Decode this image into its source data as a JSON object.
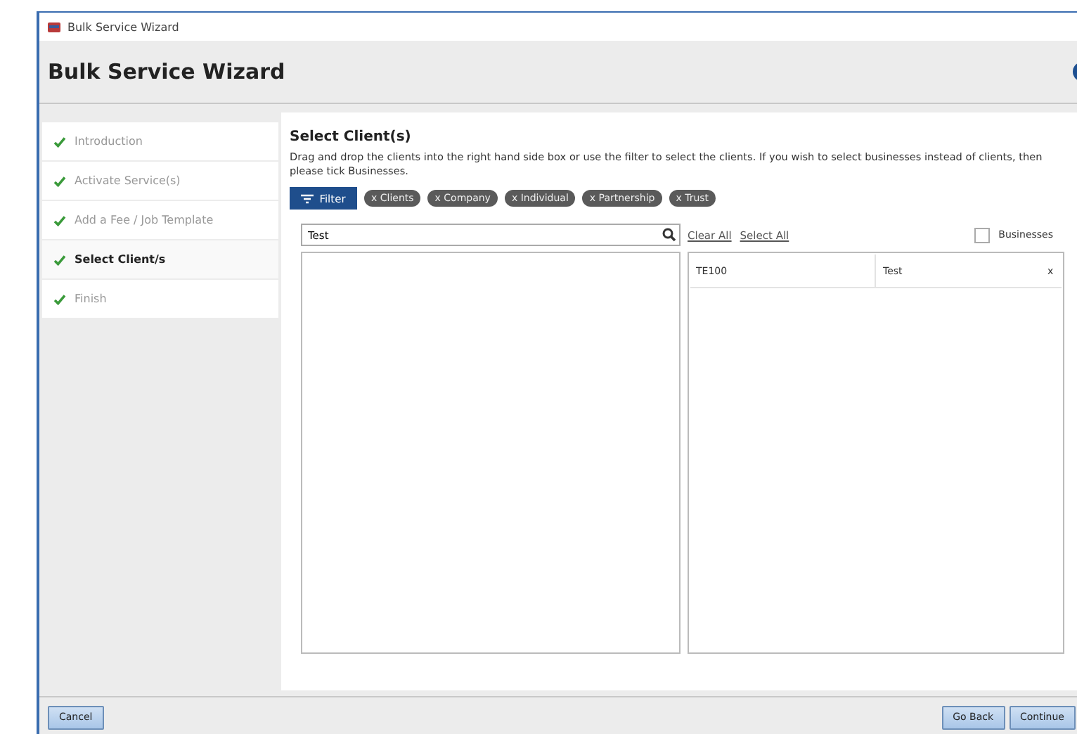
{
  "window": {
    "title": "Bulk Service Wizard"
  },
  "header": {
    "title": "Bulk Service Wizard"
  },
  "steps": [
    {
      "label": "Introduction",
      "done": true,
      "selected": false
    },
    {
      "label": "Activate Service(s)",
      "done": true,
      "selected": false
    },
    {
      "label": "Add a Fee / Job Template",
      "done": true,
      "selected": false
    },
    {
      "label": "Select Client/s",
      "done": true,
      "selected": true
    },
    {
      "label": "Finish",
      "done": true,
      "selected": false
    }
  ],
  "section": {
    "title": "Select Client(s)",
    "description": "Drag and drop the clients into the right hand side box or use the filter to select the clients.  If you wish to select businesses instead of clients, then please tick Businesses.",
    "filter_button": "Filter",
    "chips": [
      "x Clients",
      "x Company",
      "x Individual",
      "x Partnership",
      "x Trust"
    ],
    "search": {
      "value": "Test"
    },
    "links": [
      "Clear All",
      "Select All"
    ],
    "businesses": {
      "label": "Businesses",
      "checked": false
    },
    "selected_clients": [
      {
        "code": "TE100",
        "name": "Test",
        "remove": "x"
      }
    ]
  },
  "footer": {
    "left": [
      "Cancel"
    ],
    "right": [
      "Go Back",
      "Continue"
    ]
  }
}
